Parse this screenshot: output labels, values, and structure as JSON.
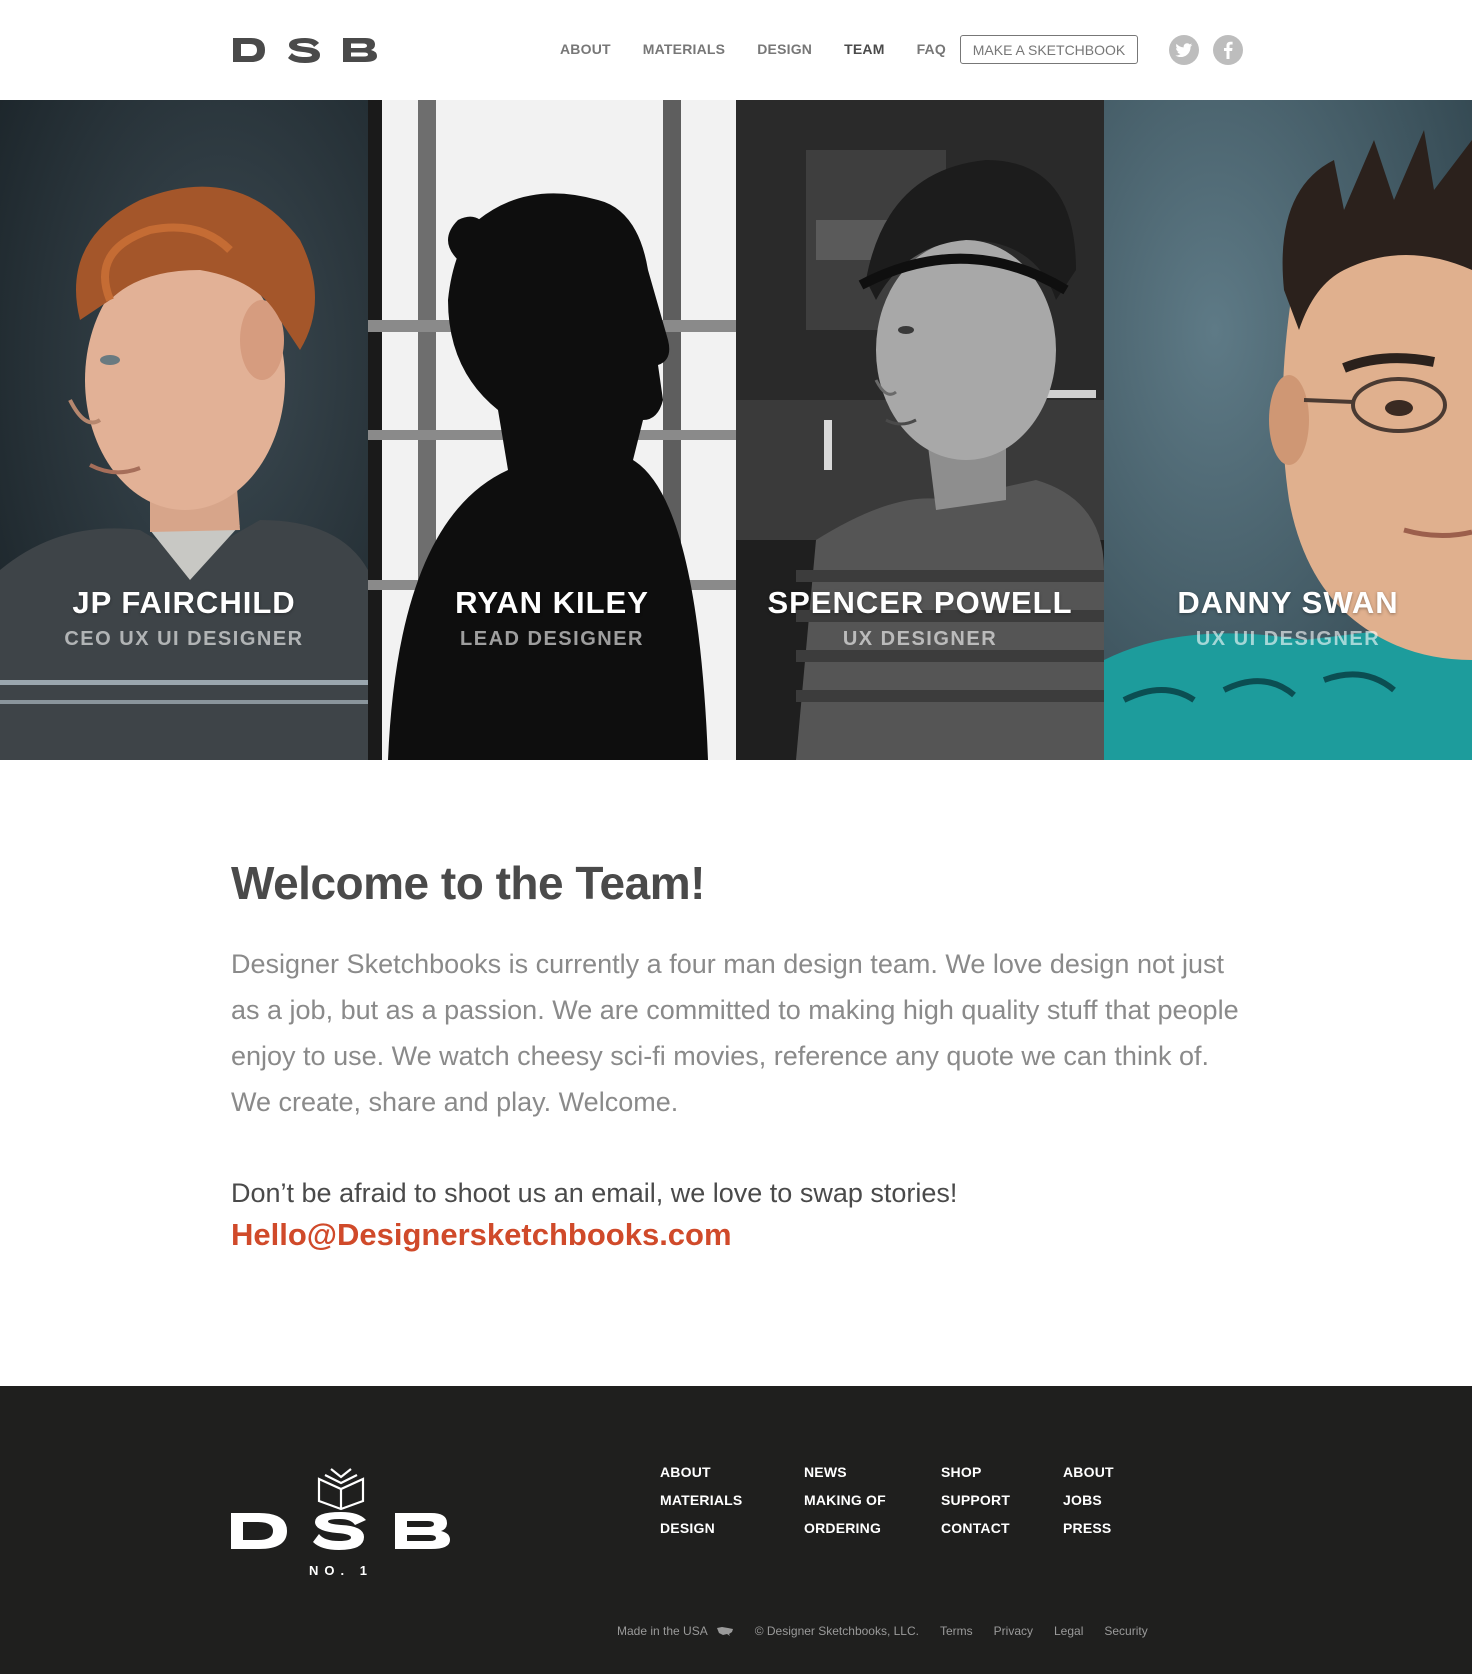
{
  "brand": {
    "logo_text": "DSB"
  },
  "nav": {
    "items": [
      {
        "label": "ABOUT"
      },
      {
        "label": "MATERIALS"
      },
      {
        "label": "DESIGN"
      },
      {
        "label": "TEAM"
      },
      {
        "label": "FAQ"
      }
    ],
    "active": "TEAM",
    "cta_label": "MAKE A SKETCHBOOK"
  },
  "social": {
    "twitter": "twitter-icon",
    "facebook": "facebook-icon"
  },
  "team": {
    "members": [
      {
        "name": "JP FAIRCHILD",
        "role": "CEO UX UI DESIGNER"
      },
      {
        "name": "RYAN KILEY",
        "role": "LEAD DESIGNER"
      },
      {
        "name": "SPENCER POWELL",
        "role": "UX DESIGNER"
      },
      {
        "name": "DANNY SWAN",
        "role": "UX UI DESIGNER"
      }
    ]
  },
  "content": {
    "title": "Welcome to the Team!",
    "intro": "Designer Sketchbooks is currently a four man design team. We love design not just as a job, but as a passion. We are committed to making high quality stuff that people enjoy to use. We watch cheesy sci-fi movies, reference any quote we can think of. We create, share and play. Welcome.",
    "contact_text": "Don’t be afraid to shoot us an email, we love to swap stories!",
    "email": "Hello@Designersketchbooks.com"
  },
  "footer": {
    "logo_text": "DSB",
    "logo_sub": "NO. 1",
    "columns": [
      [
        "ABOUT",
        "MATERIALS",
        "DESIGN"
      ],
      [
        "NEWS",
        "MAKING OF",
        "ORDERING"
      ],
      [
        "SHOP",
        "SUPPORT",
        "CONTACT"
      ],
      [
        "ABOUT",
        "JOBS",
        "PRESS"
      ]
    ],
    "bottom": {
      "made_in": "Made in the USA",
      "copyright": "© Designer Sketchbooks, LLC.",
      "links": [
        "Terms",
        "Privacy",
        "Legal",
        "Security"
      ]
    }
  },
  "colors": {
    "accent": "#d04a2a",
    "footer_bg": "#1f1f1e"
  }
}
